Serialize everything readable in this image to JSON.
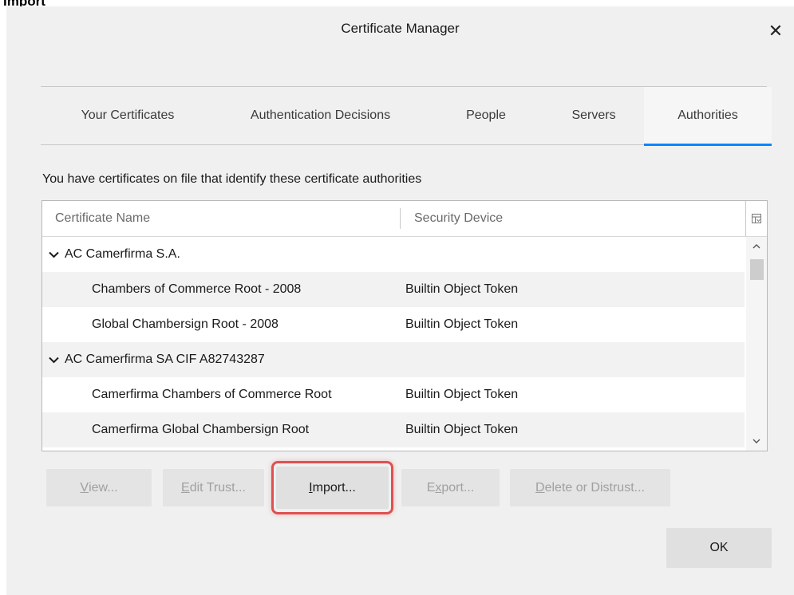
{
  "caption": "Import",
  "window": {
    "title": "Certificate Manager",
    "close_glyph": "✕"
  },
  "tabs": [
    {
      "label": "Your Certificates",
      "selected": false
    },
    {
      "label": "Authentication Decisions",
      "selected": false
    },
    {
      "label": "People",
      "selected": false
    },
    {
      "label": "Servers",
      "selected": false
    },
    {
      "label": "Authorities",
      "selected": true
    }
  ],
  "intro_text": "You have certificates on file that identify these certificate authorities",
  "table": {
    "columns": {
      "name": "Certificate Name",
      "device": "Security Device"
    },
    "column_picker_icon": "column-picker-icon",
    "rows": [
      {
        "type": "group",
        "name": "AC Camerfirma S.A.",
        "device": ""
      },
      {
        "type": "cert",
        "name": "Chambers of Commerce Root - 2008",
        "device": "Builtin Object Token"
      },
      {
        "type": "cert",
        "name": "Global Chambersign Root - 2008",
        "device": "Builtin Object Token"
      },
      {
        "type": "group",
        "name": "AC Camerfirma SA CIF A82743287",
        "device": ""
      },
      {
        "type": "cert",
        "name": "Camerfirma Chambers of Commerce Root",
        "device": "Builtin Object Token"
      },
      {
        "type": "cert",
        "name": "Camerfirma Global Chambersign Root",
        "device": "Builtin Object Token"
      }
    ]
  },
  "buttons": {
    "view": {
      "accesskey": "V",
      "rest": "iew...",
      "enabled": false
    },
    "edit_trust": {
      "accesskey": "E",
      "rest": "dit Trust...",
      "enabled": false
    },
    "import": {
      "accesskey": "I",
      "rest": "mport...",
      "enabled": true
    },
    "export": {
      "pre": "E",
      "accesskey": "x",
      "rest": "port...",
      "enabled": false
    },
    "delete": {
      "accesskey": "D",
      "rest": "elete or Distrust...",
      "enabled": false
    },
    "ok": "OK"
  },
  "highlight_color": "#e05050",
  "accent_color": "#0a84ff"
}
